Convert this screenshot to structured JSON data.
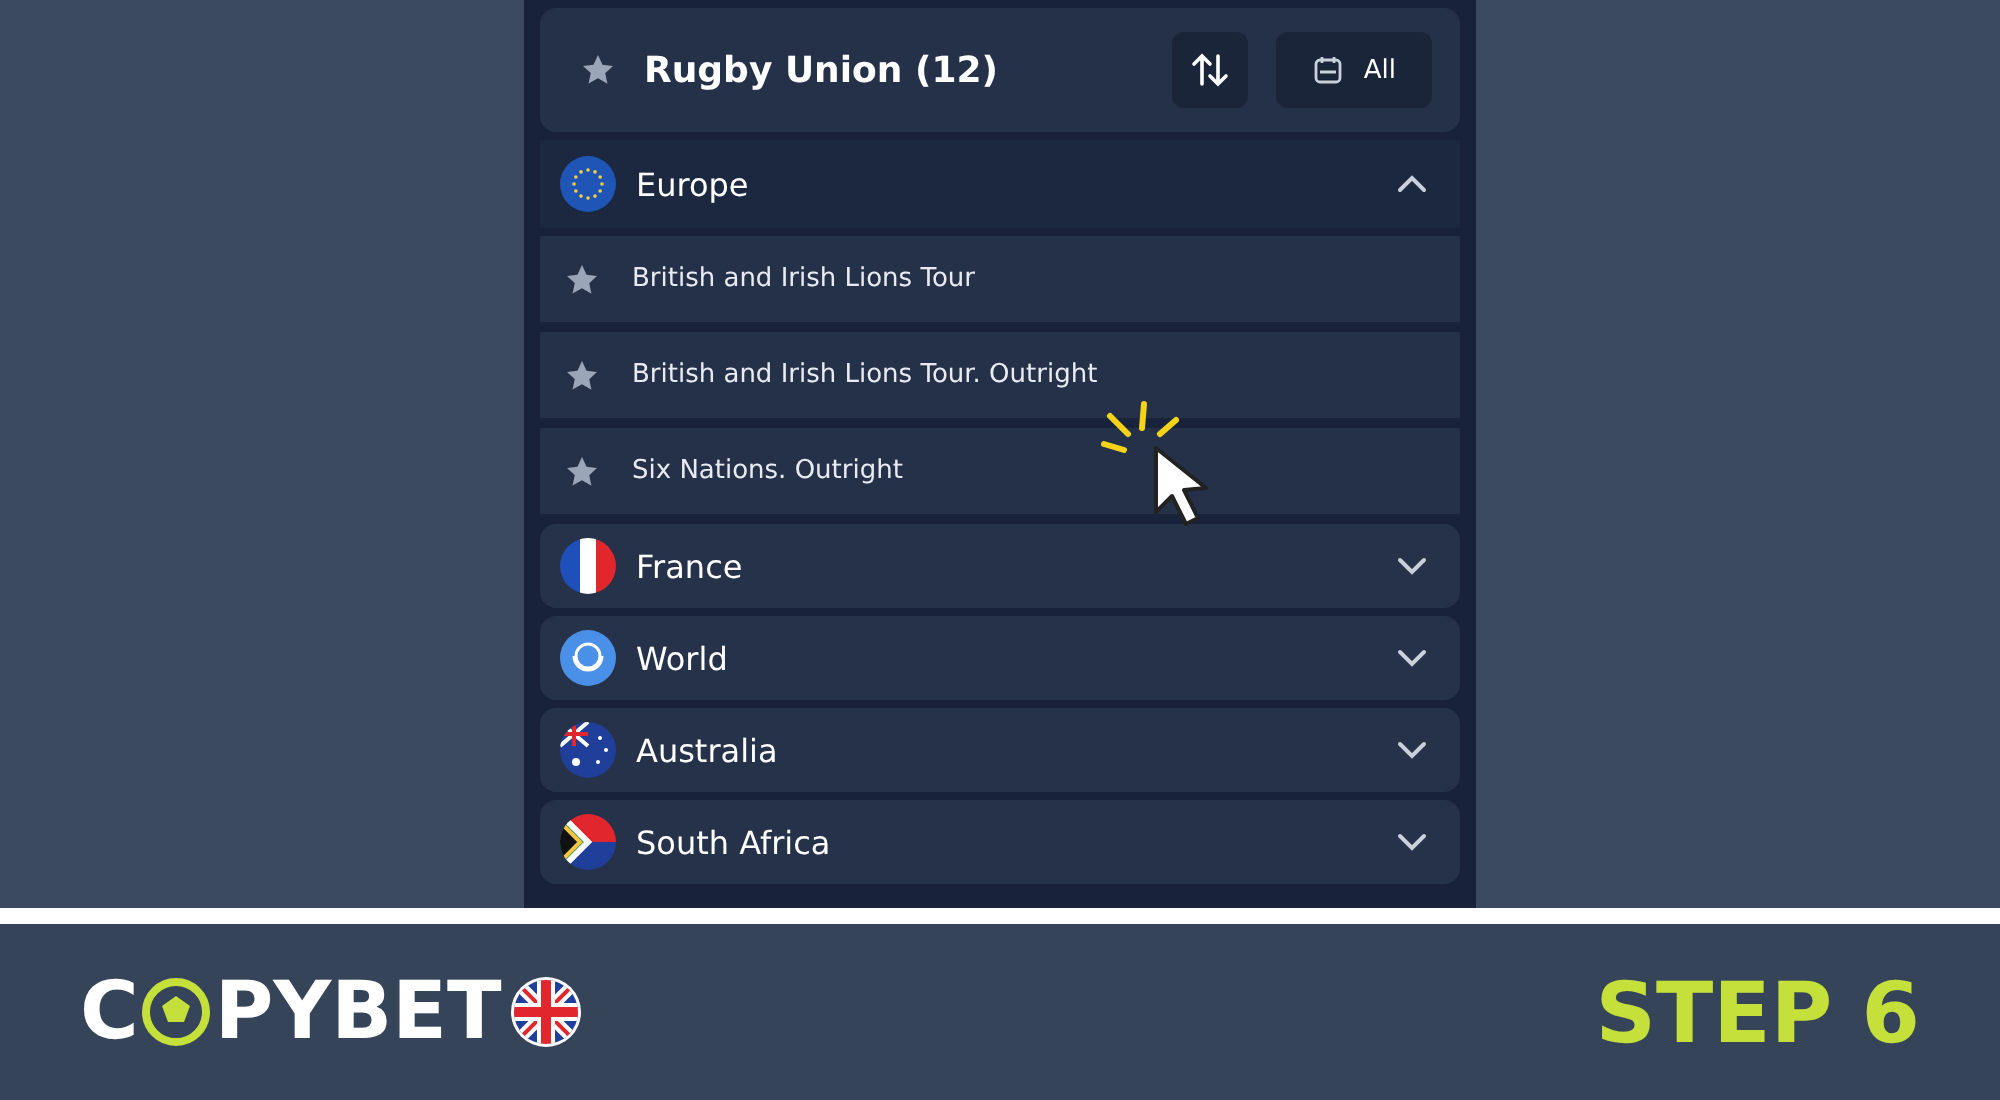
{
  "header": {
    "title": "Rugby Union (12)",
    "favorite": false,
    "filter_label": "All"
  },
  "regions": [
    {
      "name": "Europe",
      "kind": "eu",
      "expanded": true,
      "items": [
        {
          "name": "British and Irish Lions Tour",
          "favorite": false
        },
        {
          "name": "British and Irish Lions Tour. Outright",
          "favorite": false
        },
        {
          "name": "Six Nations. Outright",
          "favorite": false
        }
      ]
    },
    {
      "name": "France",
      "kind": "fr",
      "expanded": false
    },
    {
      "name": "World",
      "kind": "world",
      "expanded": false
    },
    {
      "name": "Australia",
      "kind": "au",
      "expanded": false
    },
    {
      "name": "South Africa",
      "kind": "za",
      "expanded": false
    }
  ],
  "banner": {
    "logo_start": "C",
    "logo_end": "PYBET",
    "step": "STEP 6"
  }
}
